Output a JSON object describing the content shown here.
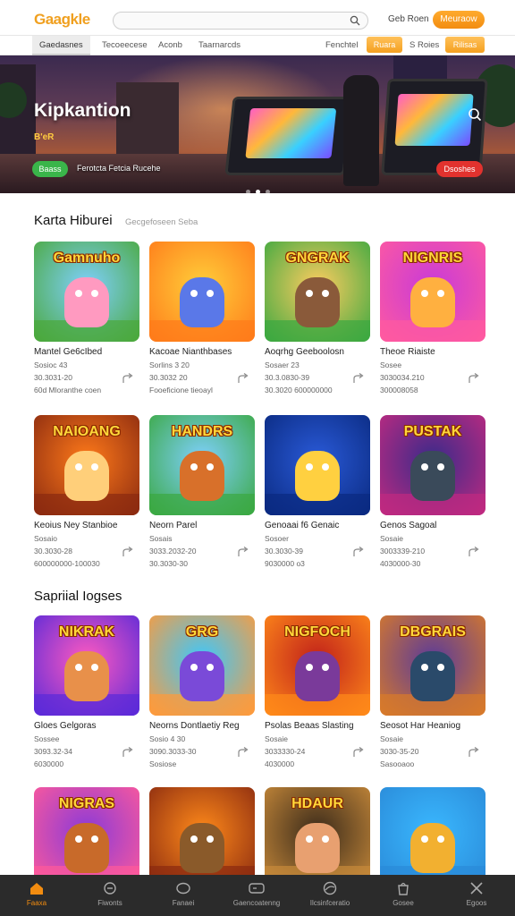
{
  "header": {
    "logo": "Gaagkle",
    "search_placeholder": "",
    "signin": "Geb Roen",
    "signup": "Meuraow"
  },
  "nav": {
    "items": [
      "Gaedasnes",
      "Tecoeecese",
      "Aconb",
      "Taarnarcds"
    ],
    "right_text_1": "Fenchtel",
    "pill_1": "Ruara",
    "right_text_2": "S Roies",
    "pill_2": "Rilisas"
  },
  "hero": {
    "title": "Kipkantion",
    "subtitle": "B'eR",
    "cta": "Baass",
    "caption": "Ferotcta Fetcia Rucehe",
    "button": "Dsoshes",
    "dots": 3,
    "active_dot": 1
  },
  "section1": {
    "title": "Karta Hiburei",
    "subtitle": "Gecgefoseen Seba"
  },
  "section2": {
    "title": "Sapriial Iogses"
  },
  "cards": [
    {
      "thumb_title": "Gamnuho",
      "name": "Mantel Ge6cIbed",
      "l2": "Sosioc 43",
      "l3": "30.3031-20",
      "l4": "60d Mloranthe coen",
      "c1": "#7fd0ff",
      "c2": "#4aa83a",
      "char": "#ff9ac0"
    },
    {
      "thumb_title": "",
      "name": "Kacoae Nianthbases",
      "l2": "Sorlins 3 20",
      "l3": "30.3032 20",
      "l4": "Fooeficione tieoayl",
      "c1": "#ffcf3a",
      "c2": "#ff7a1a",
      "char": "#5a78e8"
    },
    {
      "thumb_title": "GNGRAK",
      "name": "Aoqrhg Geeboolosn",
      "l2": "Sosaer 23",
      "l3": "30.3.0830-39",
      "l4": "30.3020 600000000",
      "c1": "#ffcc60",
      "c2": "#3aa840",
      "char": "#8a5a3a"
    },
    {
      "thumb_title": "NIGNRIS",
      "name": "Theoe Riaiste",
      "l2": "Sosee",
      "l3": "3030034.210",
      "l4": "300008058",
      "c1": "#c83ad8",
      "c2": "#ff5aa0",
      "char": "#ffb040"
    },
    {
      "thumb_title": "NAIOANG",
      "name": "Keoius Ney Stanbioe",
      "l2": "Sosaio",
      "l3": "30.3030-28",
      "l4": "600000000-100030",
      "c1": "#ff7a1a",
      "c2": "#8a2a10",
      "char": "#ffcf7a"
    },
    {
      "thumb_title": "HANDRS",
      "name": "Neorn Parel",
      "l2": "Sosais",
      "l3": "3033.2032-20",
      "l4": "30.3030-30",
      "c1": "#7fd0ff",
      "c2": "#3aa840",
      "char": "#d8702a"
    },
    {
      "thumb_title": "",
      "name": "Genoaai f6 Genaic",
      "l2": "Sosoer",
      "l3": "30.3030-39",
      "l4": "9030000 o3",
      "c1": "#2a5ad8",
      "c2": "#0a2a80",
      "char": "#ffd040"
    },
    {
      "thumb_title": "PUSTAK",
      "name": "Genos Sagoal",
      "l2": "Sosaie",
      "l3": "3003339-210",
      "l4": "4030000-30",
      "c1": "#3a2a8a",
      "c2": "#c02a80",
      "char": "#3a4a5a"
    },
    {
      "thumb_title": "NIKRAK",
      "name": "Gloes Gelgoras",
      "l2": "Sossee",
      "l3": "3093.32-34",
      "l4": "6030000",
      "c1": "#ff5ac0",
      "c2": "#5a2ad8",
      "char": "#e8904a"
    },
    {
      "thumb_title": "GRG",
      "name": "Neorns Dontlaetiy Reg",
      "l2": "Sosio 4 30",
      "l3": "3090.3033-30",
      "l4": "Sosiose",
      "c1": "#3ac8ff",
      "c2": "#ff9a3a",
      "char": "#7a4ad8"
    },
    {
      "thumb_title": "NIGFOCH",
      "name": "Psolas Beaas Slasting",
      "l2": "Sosaie",
      "l3": "3033330-24",
      "l4": "4030000",
      "c1": "#c0201a",
      "c2": "#ff8a1a",
      "char": "#7a3a9a"
    },
    {
      "thumb_title": "DBGRAIS",
      "name": "Seosot Har Heaniog",
      "l2": "Sosaie",
      "l3": "3030-35-20",
      "l4": "Sasooaoo",
      "c1": "#5a3a9a",
      "c2": "#d87a2a",
      "char": "#2a4a6a"
    },
    {
      "thumb_title": "NIGRAS",
      "name": "",
      "l2": "",
      "l3": "",
      "l4": "",
      "c1": "#8a3ad8",
      "c2": "#ff5a9a",
      "char": "#c86a2a"
    },
    {
      "thumb_title": "",
      "name": "",
      "l2": "",
      "l3": "",
      "l4": "",
      "c1": "#ff8a1a",
      "c2": "#8a2a10",
      "char": "#8a5a2a"
    },
    {
      "thumb_title": "HDAUR",
      "name": "",
      "l2": "",
      "l3": "",
      "l4": "",
      "c1": "#3a2a1a",
      "c2": "#c88a3a",
      "char": "#e8a070"
    },
    {
      "thumb_title": "",
      "name": "",
      "l2": "",
      "l3": "",
      "l4": "",
      "c1": "#3ab8ff",
      "c2": "#2a8ad8",
      "char": "#f2b030"
    }
  ],
  "bottom_tabs": [
    {
      "label": "Faaxa",
      "icon": "home-icon"
    },
    {
      "label": "Fiwonts",
      "icon": "circle-icon"
    },
    {
      "label": "Fanaei",
      "icon": "chat-icon"
    },
    {
      "label": "Gaencoatenng",
      "icon": "gamepad-icon"
    },
    {
      "label": "Ilcsinfceratio",
      "icon": "globe-icon"
    },
    {
      "label": "Gosee",
      "icon": "bag-icon"
    },
    {
      "label": "Egoos",
      "icon": "tools-icon"
    }
  ],
  "colors": {
    "accent": "#f28c10",
    "green": "#3ab54a",
    "red": "#e2322e",
    "bottombar": "#2b2b2b"
  }
}
